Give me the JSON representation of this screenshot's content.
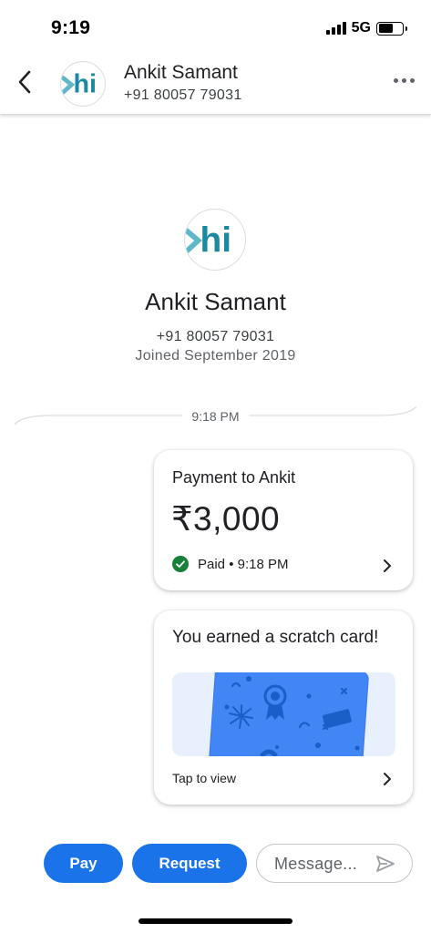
{
  "status_bar": {
    "time": "9:19",
    "network": "5G",
    "battery_level": 0.6
  },
  "header": {
    "contact_name": "Ankit Samant",
    "contact_phone": "+91 80057 79031",
    "avatar_text": "hi"
  },
  "profile": {
    "avatar_text": "hi",
    "name": "Ankit Samant",
    "phone": "+91 80057 79031",
    "joined": "Joined September 2019"
  },
  "conversation": {
    "time_divider": "9:18 PM",
    "payment_card": {
      "title": "Payment to Ankit",
      "amount": "₹3,000",
      "status": "Paid • 9:18 PM"
    },
    "scratch_card": {
      "title": "You earned a scratch card!",
      "action": "Tap to view"
    }
  },
  "bottom_bar": {
    "pay_label": "Pay",
    "request_label": "Request",
    "message_placeholder": "Message..."
  },
  "colors": {
    "primary": "#1a73e8",
    "paid_green": "#188038",
    "avatar_teal": "#1b8aa0",
    "scratch_bg": "#e8f0fe",
    "scratch_card": "#4285f4"
  },
  "icons": [
    "back-arrow-icon",
    "more-vert-icon",
    "check-circle-icon",
    "chevron-right-icon",
    "send-icon"
  ]
}
